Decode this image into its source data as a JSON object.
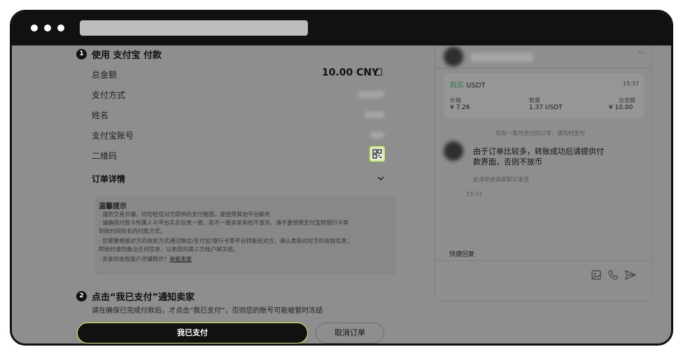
{
  "step1": {
    "number": "1",
    "title": "使用 支付宝 付款",
    "rows": [
      {
        "label": "总金额",
        "value": "10.00 CNY"
      },
      {
        "label": "支付方式"
      },
      {
        "label": "姓名"
      },
      {
        "label": "支付宝账号"
      },
      {
        "label": "二维码"
      }
    ],
    "order_details": "订单详情"
  },
  "tips": {
    "title": "温馨提示",
    "lines": [
      "· 谨防交易诈骗，切勿轻信对方提供的支付截图，或使用其他平台聊天",
      "· 请确保付款卡所属人与平台实名信息一致，若不一致卖家有权不放币，请不要使用支付宝转银行卡等",
      "  到账时间较长的付款方式。",
      "· 您需要根据对方的收款方式通过微信/支付宝/银行卡等平台转账给对方，请认真核对对方的收款信息；",
      "  转账时请勿备注任何信息，以免您的第三方账户被冻结。"
    ],
    "last_line_prefix": "· 卖家的收款账户涉嫌欺诈？",
    "report_link": "举报卖家"
  },
  "step2": {
    "number": "2",
    "title": "点击“我已支付”通知卖家",
    "desc": "请在确保已完成付款后，才点击“我已支付”，否则您的账号可能被暂时冻结"
  },
  "buttons": {
    "paid": "我已支付",
    "cancel": "取消订单"
  },
  "chat": {
    "more": "···",
    "order": {
      "type": "购买",
      "asset": "USDT",
      "time": "15:37",
      "price_label": "价格",
      "price": "¥ 7.26",
      "qty_label": "数量",
      "qty": "1.37 USDT",
      "total_label": "总金额",
      "total": "¥ 10.00"
    },
    "system_msg": "您有一笔待支付的订单，请及时支付",
    "message": "由于订单比较多，转账成功后请提供付款界面，否则不放币",
    "message_line1": "由于订单比较多，转账成功后请提供付",
    "message_line2": "款界面，否则不放币",
    "auto_note": "此消息由商家默认发送",
    "message_time": "15:37",
    "quick_reply": "快捷回复"
  },
  "colors": {
    "accent": "#c4f35a",
    "buy_green": "#2e8b57",
    "overlay": "#8e8e8e"
  }
}
